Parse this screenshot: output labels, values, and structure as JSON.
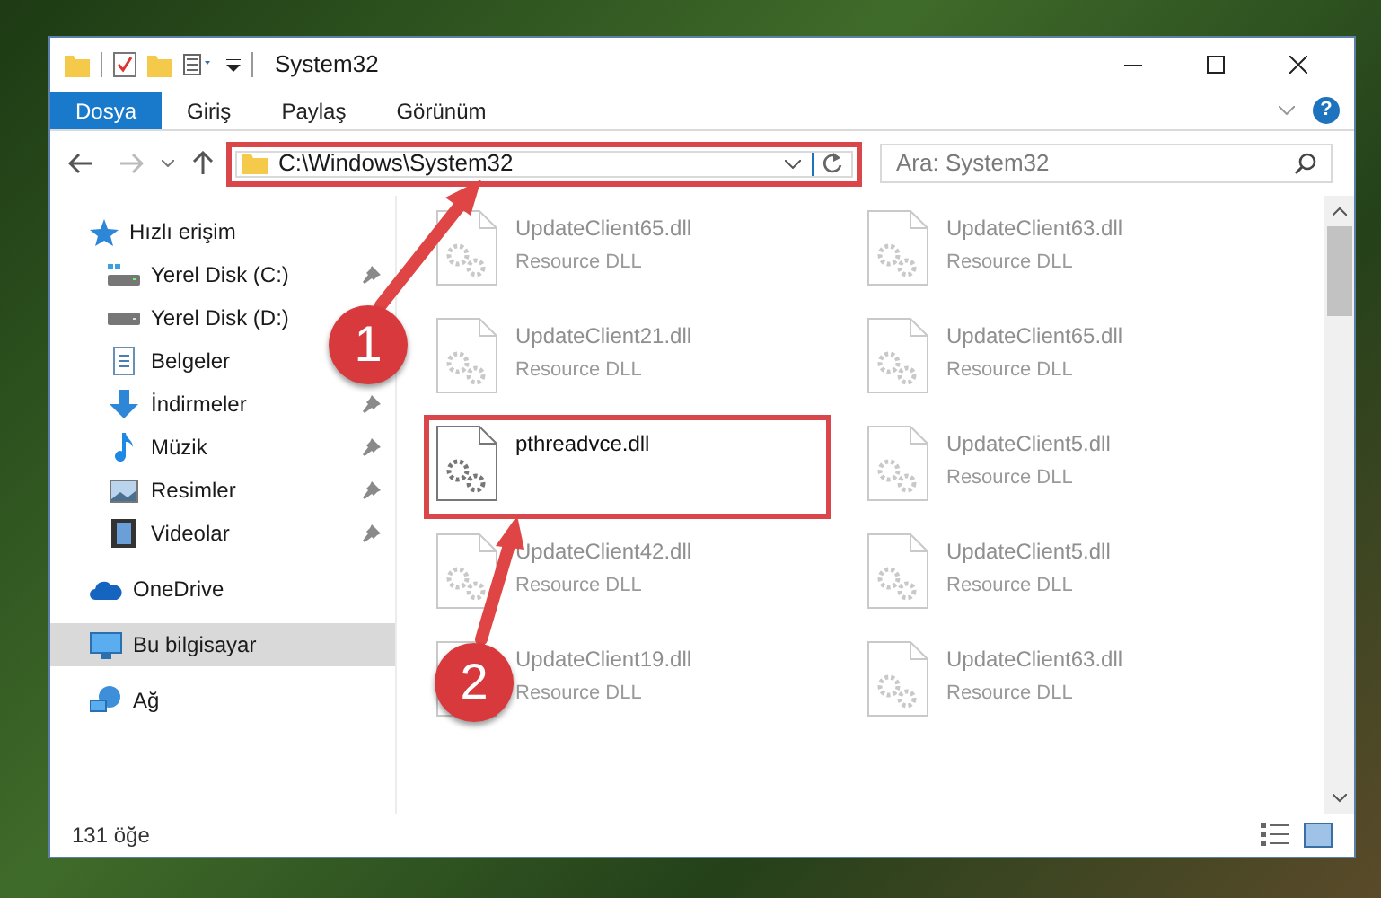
{
  "window": {
    "title": "System32"
  },
  "ribbon_tabs": [
    {
      "label": "Dosya",
      "selected": true
    },
    {
      "label": "Giriş",
      "selected": false
    },
    {
      "label": "Paylaş",
      "selected": false
    },
    {
      "label": "Görünüm",
      "selected": false
    }
  ],
  "help_button": {
    "label": "?"
  },
  "address_bar": {
    "path": "C:\\Windows\\System32",
    "highlighted": true
  },
  "search": {
    "placeholder": "Ara: System32"
  },
  "sidebar": {
    "items": [
      {
        "label": "Hızlı erişim",
        "selected": false,
        "children": [
          {
            "label": "Yerel Disk (C:)",
            "pinned": true
          },
          {
            "label": "Yerel Disk (D:)",
            "pinned": false
          },
          {
            "label": "Belgeler",
            "pinned": false
          },
          {
            "label": "İndirmeler",
            "pinned": true
          },
          {
            "label": "Müzik",
            "pinned": true
          },
          {
            "label": "Resimler",
            "pinned": true
          },
          {
            "label": "Videolar",
            "pinned": true
          }
        ]
      },
      {
        "label": "OneDrive",
        "selected": false
      },
      {
        "label": "Bu bilgisayar",
        "selected": true
      },
      {
        "label": "Ağ",
        "selected": false
      }
    ]
  },
  "files": [
    {
      "name": "UpdateClient65.dll",
      "type": "Resource DLL",
      "faded": true,
      "highlighted": false
    },
    {
      "name": "UpdateClient63.dll",
      "type": "Resource DLL",
      "faded": true,
      "highlighted": false
    },
    {
      "name": "UpdateClient21.dll",
      "type": "Resource DLL",
      "faded": true,
      "highlighted": false
    },
    {
      "name": "UpdateClient65.dll",
      "type": "Resource DLL",
      "faded": true,
      "highlighted": false
    },
    {
      "name": "pthreadvce.dll",
      "faded": false,
      "highlighted": true
    },
    {
      "name": "UpdateClient5.dll",
      "type": "Resource DLL",
      "faded": true,
      "highlighted": false
    },
    {
      "name": "UpdateClient42.dll",
      "type": "Resource DLL",
      "faded": true,
      "highlighted": false
    },
    {
      "name": "UpdateClient5.dll",
      "type": "Resource DLL",
      "faded": true,
      "highlighted": false
    },
    {
      "name": "UpdateClient19.dll",
      "type": "Resource DLL",
      "faded": true,
      "highlighted": false
    },
    {
      "name": "UpdateClient63.dll",
      "type": "Resource DLL",
      "faded": true,
      "highlighted": false
    }
  ],
  "status_bar": {
    "item_count": "131 öğe"
  },
  "annotations": [
    {
      "number": "1"
    },
    {
      "number": "2"
    }
  ]
}
